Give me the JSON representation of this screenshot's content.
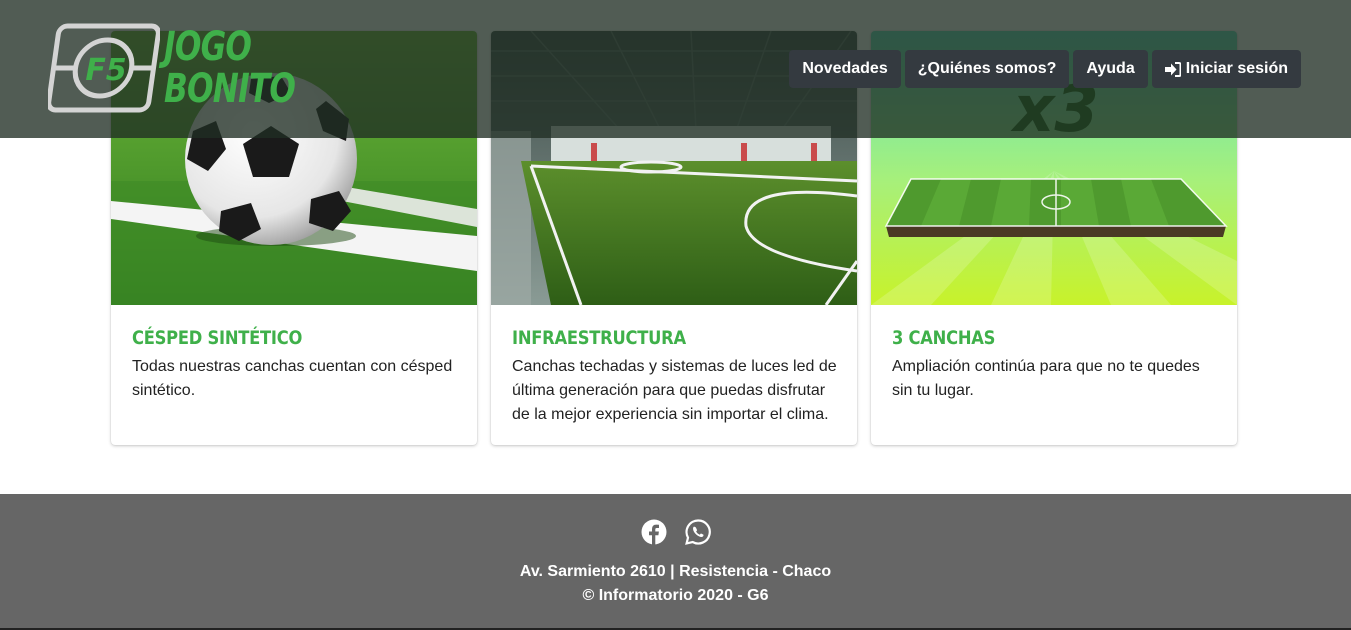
{
  "brand": {
    "logo_mark_text": "F5",
    "name_line1": "JOGO",
    "name_line2": "BONITO",
    "accent_color": "#3fb04a"
  },
  "nav": {
    "items": [
      {
        "label": "Novedades"
      },
      {
        "label": "¿Quiénes somos?"
      },
      {
        "label": "Ayuda"
      },
      {
        "label": "Iniciar sesión",
        "icon": "sign-in-icon"
      }
    ]
  },
  "cards": [
    {
      "image": "soccer-ball-on-grass",
      "title": "CÉSPED SINTÉTICO",
      "text": "Todas nuestras canchas cuentan con césped sintético."
    },
    {
      "image": "indoor-field",
      "title": "INFRAESTRUCTURA",
      "text": "Canchas techadas y sistemas de luces led de última generación para que puedas disfrutar de la mejor experiencia sin importar el clima."
    },
    {
      "image": "three-fields-graphic",
      "image_text": "x3",
      "title": "3 CANCHAS",
      "text": "Ampliación continúa para que no te quedes sin tu lugar."
    }
  ],
  "footer": {
    "social": [
      "facebook-icon",
      "whatsapp-icon"
    ],
    "address": "Av. Sarmiento 2610 | Resistencia - Chaco",
    "copyright": "© Informatorio 2020 - G6"
  }
}
